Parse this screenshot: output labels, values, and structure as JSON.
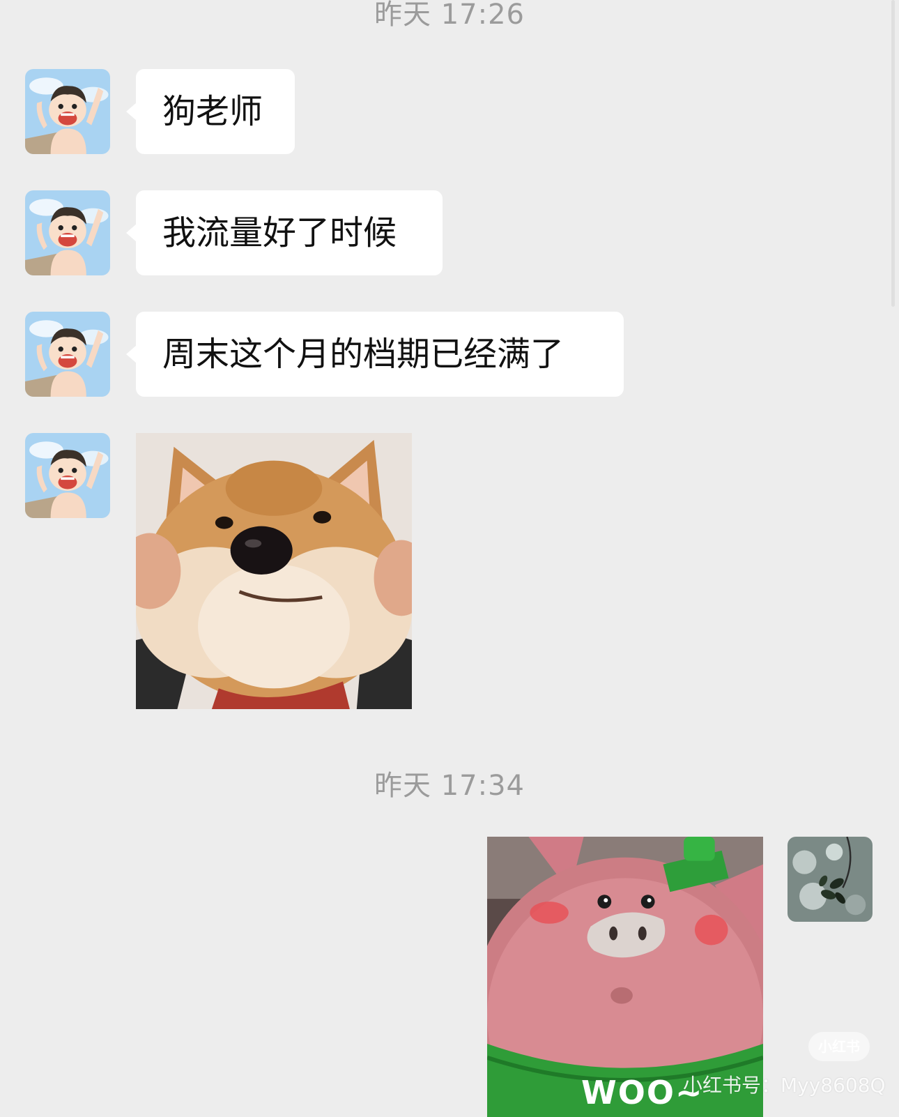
{
  "chat": {
    "timestamp_1": "昨天 17:26",
    "timestamp_2": "昨天 17:34",
    "messages": [
      {
        "sender": "contact",
        "type": "text",
        "text": "狗老师"
      },
      {
        "sender": "contact",
        "type": "text",
        "text": "我流量好了时候"
      },
      {
        "sender": "contact",
        "type": "text",
        "text": "周末这个月的档期已经满了"
      },
      {
        "sender": "contact",
        "type": "sticker",
        "sticker": "shiba-dog-cheeks-sticker"
      },
      {
        "sender": "me",
        "type": "sticker",
        "sticker": "felt-pig-sticker",
        "caption": "WOO~"
      }
    ]
  },
  "watermark": {
    "logo": "小红书",
    "text": "小红书号：Myy8608Q"
  },
  "colors": {
    "background": "#ededed",
    "bubble": "#ffffff",
    "timestamp": "#9b9b9b"
  }
}
